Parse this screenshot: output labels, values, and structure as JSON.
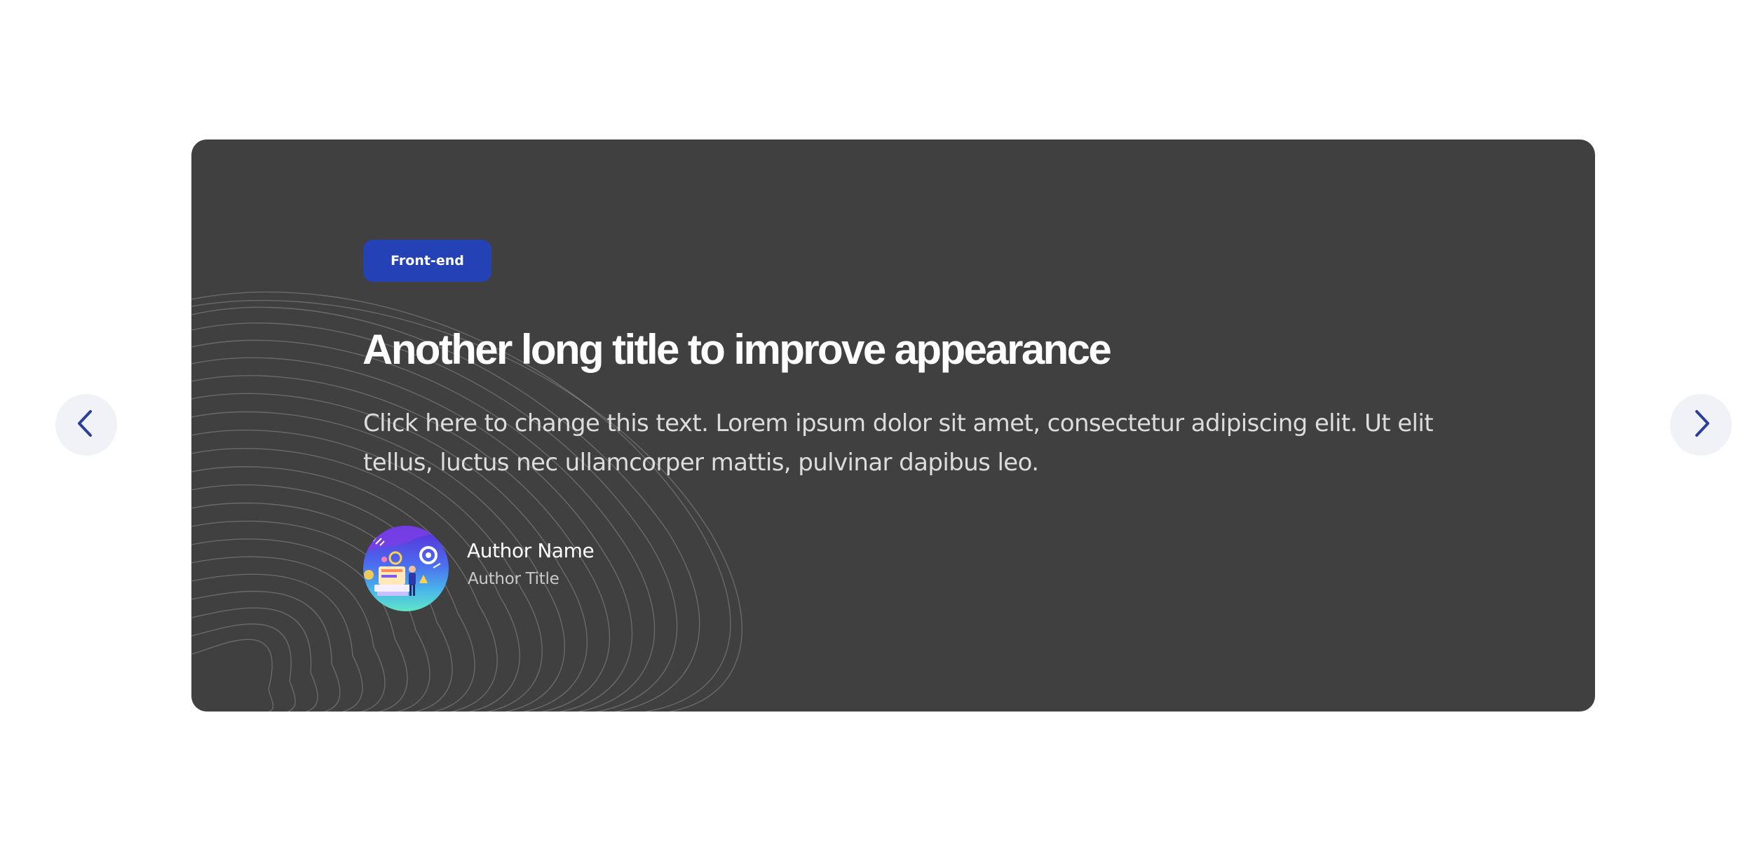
{
  "slider": {
    "prev_icon": "chevron-left-icon",
    "next_icon": "chevron-right-icon",
    "arrow_color": "#2a3f9c",
    "arrow_background": "#f1f2f8"
  },
  "slide": {
    "background": "#404040",
    "category": "Front-end",
    "category_color": "#2442b6",
    "title": "Another long title to improve appearance",
    "description": "Click here to change this text. Lorem ipsum dolor sit amet, consectetur adipiscing elit. Ut elit tellus, luctus nec ullamcorper mattis, pulvinar dapibus leo.",
    "author": {
      "name": "Author Name",
      "title": "Author Title",
      "avatar_icon": "developer-illustration-icon"
    }
  }
}
